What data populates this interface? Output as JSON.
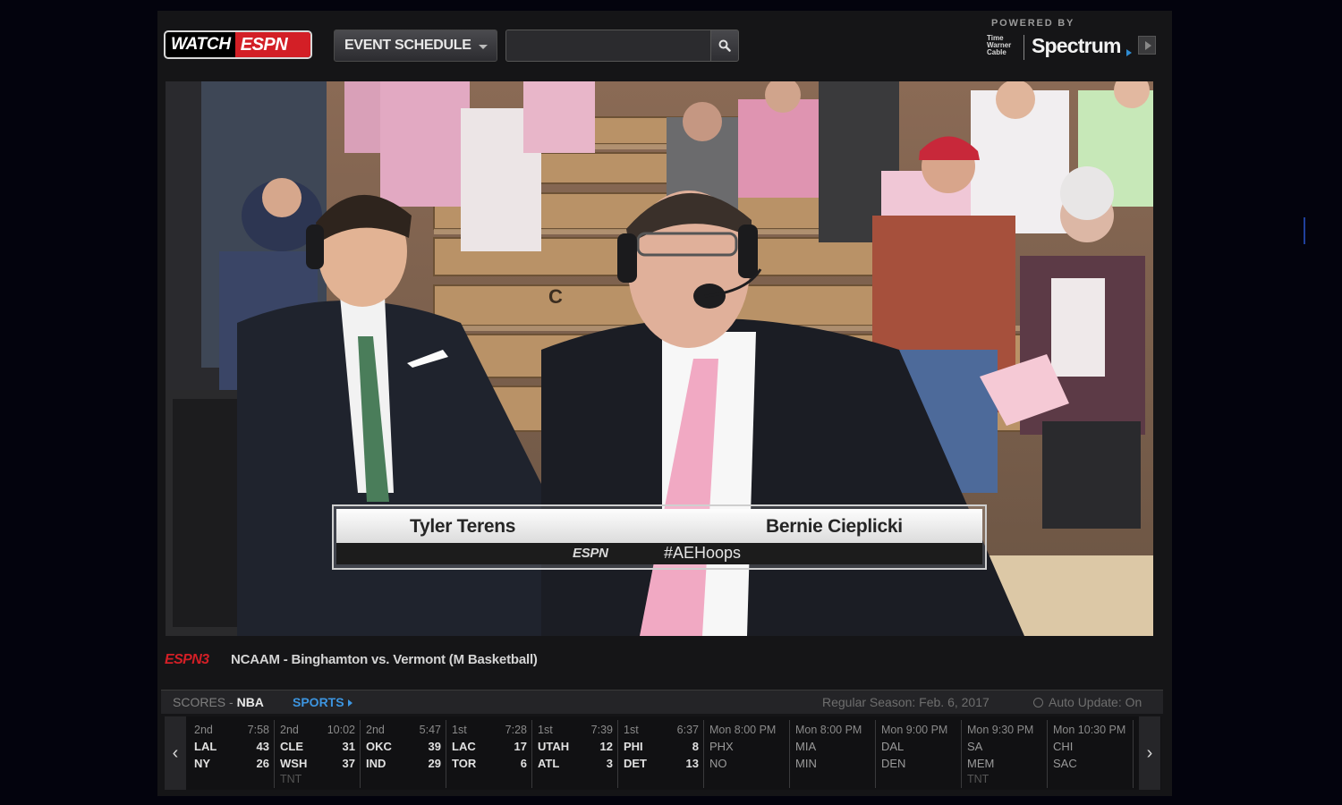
{
  "header": {
    "logo_watch": "WATCH",
    "logo_espn": "ESPN",
    "event_schedule_label": "EVENT SCHEDULE",
    "search_placeholder": "",
    "powered_by": "POWERED BY",
    "twc": "Time Warner Cable",
    "spectrum": "Spectrum"
  },
  "video": {
    "lower_third": {
      "name_left": "Tyler Terens",
      "name_right": "Bernie Cieplicki",
      "network": "ESPN",
      "hashtag": "#AEHoops"
    },
    "scene_sign": "C"
  },
  "event": {
    "network": "ESPN3",
    "title": "NCAAM - Binghamton vs. Vermont (M Basketball)"
  },
  "scores": {
    "label": "SCORES - ",
    "league": "NBA",
    "sports_link": "SPORTS",
    "season": "Regular Season: Feb. 6, 2017",
    "auto_update": "Auto Update: On",
    "games": [
      {
        "period": "2nd",
        "time": "7:58",
        "away": "LAL",
        "away_score": "43",
        "home": "NY",
        "home_score": "26",
        "tv": ""
      },
      {
        "period": "2nd",
        "time": "10:02",
        "away": "CLE",
        "away_score": "31",
        "home": "WSH",
        "home_score": "37",
        "tv": "TNT"
      },
      {
        "period": "2nd",
        "time": "5:47",
        "away": "OKC",
        "away_score": "39",
        "home": "IND",
        "home_score": "29",
        "tv": ""
      },
      {
        "period": "1st",
        "time": "7:28",
        "away": "LAC",
        "away_score": "17",
        "home": "TOR",
        "home_score": "6",
        "tv": ""
      },
      {
        "period": "1st",
        "time": "7:39",
        "away": "UTAH",
        "away_score": "12",
        "home": "ATL",
        "home_score": "3",
        "tv": ""
      },
      {
        "period": "1st",
        "time": "6:37",
        "away": "PHI",
        "away_score": "8",
        "home": "DET",
        "home_score": "13",
        "tv": ""
      },
      {
        "period": "Mon 8:00 PM",
        "time": "",
        "away": "PHX",
        "away_score": "",
        "home": "NO",
        "home_score": "",
        "tv": ""
      },
      {
        "period": "Mon 8:00 PM",
        "time": "",
        "away": "MIA",
        "away_score": "",
        "home": "MIN",
        "home_score": "",
        "tv": ""
      },
      {
        "period": "Mon 9:00 PM",
        "time": "",
        "away": "DAL",
        "away_score": "",
        "home": "DEN",
        "home_score": "",
        "tv": ""
      },
      {
        "period": "Mon 9:30 PM",
        "time": "",
        "away": "SA",
        "away_score": "",
        "home": "MEM",
        "home_score": "",
        "tv": "TNT"
      },
      {
        "period": "Mon 10:30 PM",
        "time": "",
        "away": "CHI",
        "away_score": "",
        "home": "SAC",
        "home_score": "",
        "tv": ""
      }
    ]
  },
  "icons": {
    "search": "search-icon",
    "prev": "chevron-left-icon",
    "next": "chevron-right-icon",
    "clock": "clock-icon"
  },
  "colors": {
    "espn_red": "#d31f26",
    "link_blue": "#3d95e0",
    "background": "#03030d"
  }
}
